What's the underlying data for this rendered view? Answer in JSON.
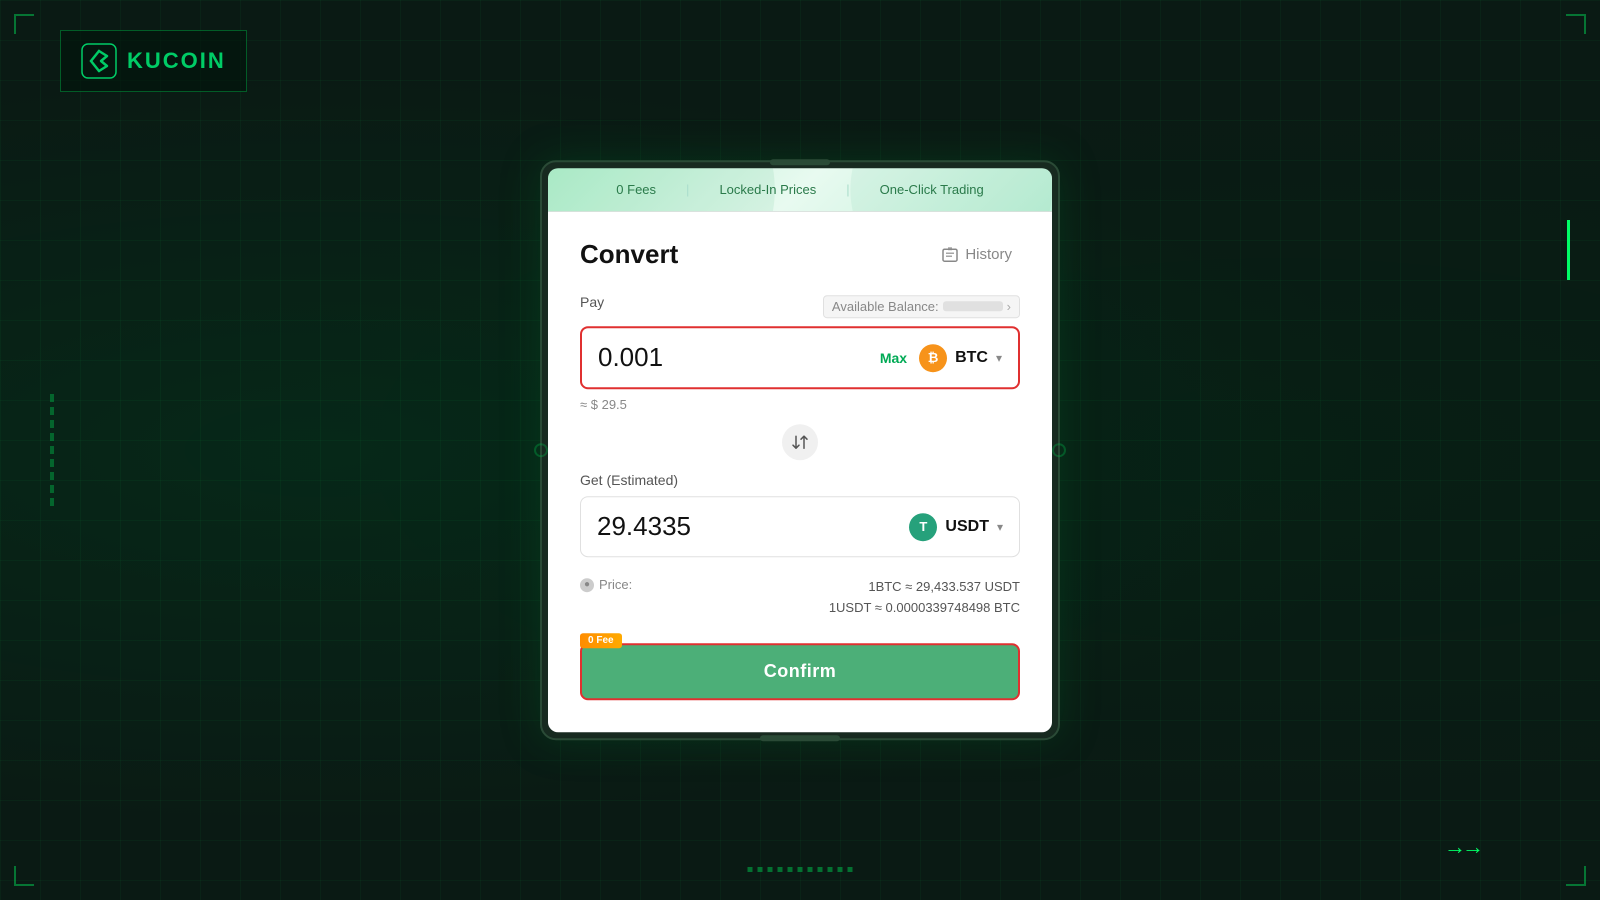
{
  "background": {
    "color": "#0a1a14"
  },
  "logo": {
    "text": "KUCOIN",
    "icon": "kucoin-icon"
  },
  "banner": {
    "items": [
      "0 Fees",
      "Locked-In Prices",
      "One-Click Trading"
    ]
  },
  "modal": {
    "title": "Convert",
    "history_label": "History",
    "pay_label": "Pay",
    "available_balance_label": "Available Balance:",
    "pay_value": "0.001",
    "max_label": "Max",
    "pay_token": "BTC",
    "usd_approx": "≈ $ 29.5",
    "swap_icon": "⇄",
    "get_label": "Get (Estimated)",
    "get_value": "29.4335",
    "get_token": "USDT",
    "price_label": "Price:",
    "price_line1": "1BTC ≈ 29,433.537 USDT",
    "price_line2": "1USDT ≈ 0.0000339748498 BTC",
    "zero_fee_badge": "0 Fee",
    "confirm_label": "Confirm"
  }
}
